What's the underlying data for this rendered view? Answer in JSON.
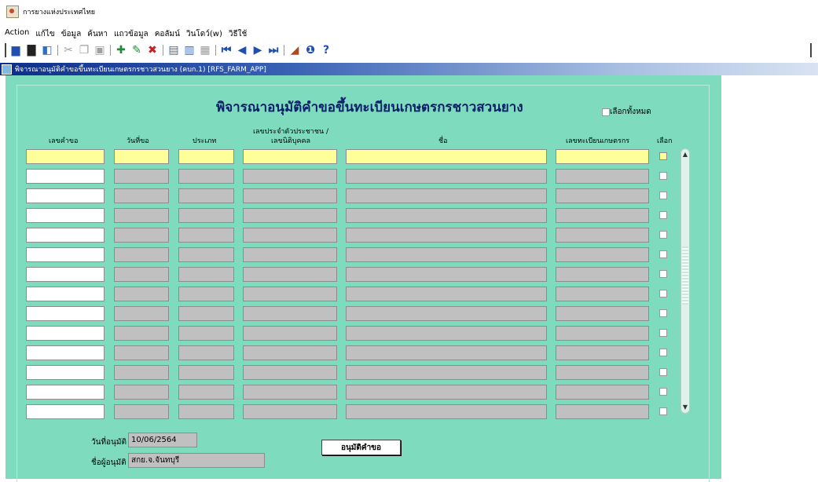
{
  "app": {
    "title": "การยางแห่งประเทศไทย"
  },
  "menu": [
    "Action",
    "แก้ไข",
    "ข้อมูล",
    "ค้นหา",
    "แถวข้อมูล",
    "คอลัมน์",
    "วินโดว์(w)",
    "วิธีใช้"
  ],
  "toolbar": [
    {
      "icon": "save-icon",
      "glyph": "▆",
      "color": "#1f4fb0"
    },
    {
      "icon": "print-icon",
      "glyph": "▇",
      "color": "#222222"
    },
    {
      "icon": "exit-icon",
      "glyph": "◧",
      "color": "#2a6fd0"
    },
    {
      "sep": true
    },
    {
      "icon": "cut-icon",
      "glyph": "✂",
      "color": "#a0a0a0"
    },
    {
      "icon": "copy-icon",
      "glyph": "❐",
      "color": "#a0a0a0"
    },
    {
      "icon": "paste-icon",
      "glyph": "▣",
      "color": "#a0a0a0"
    },
    {
      "sep": true
    },
    {
      "icon": "insert-record-icon",
      "glyph": "✚",
      "color": "#1e8a3a"
    },
    {
      "icon": "edit-record-icon",
      "glyph": "✎",
      "color": "#1e8a3a"
    },
    {
      "icon": "delete-record-icon",
      "glyph": "✖",
      "color": "#c81e1e"
    },
    {
      "sep": true
    },
    {
      "icon": "query-icon",
      "glyph": "▤",
      "color": "#2a6fd0"
    },
    {
      "icon": "execute-query-icon",
      "glyph": "▥",
      "color": "#2a6fd0"
    },
    {
      "icon": "cancel-query-icon",
      "glyph": "▦",
      "color": "#9a9a9a"
    },
    {
      "sep": true
    },
    {
      "icon": "first-record-icon",
      "glyph": "⏮",
      "color": "#1f4fb0"
    },
    {
      "icon": "previous-record-icon",
      "glyph": "◀",
      "color": "#1f4fb0"
    },
    {
      "icon": "next-record-icon",
      "glyph": "▶",
      "color": "#1f4fb0"
    },
    {
      "icon": "last-record-icon",
      "glyph": "⏭",
      "color": "#1f4fb0"
    },
    {
      "sep": true
    },
    {
      "icon": "chart-icon",
      "glyph": "◢",
      "color": "#b04a1a"
    },
    {
      "icon": "info-icon",
      "glyph": "❶",
      "color": "#1f4fb0"
    },
    {
      "icon": "help-icon",
      "glyph": "?",
      "color": "#1f4fb0"
    }
  ],
  "window": {
    "title": "พิจารณาอนุมัติคำขอขึ้นทะเบียนเกษตรกรชาวสวนยาง (คบก.1) [RFS_FARM_APP]"
  },
  "form": {
    "title": "พิจารณาอนุมัติคำขอขึ้นทะเบียนเกษตรกรชาวสวนยาง",
    "select_all": "เลือกทั้งหมด",
    "columns": {
      "request_no": "เลขคำขอ",
      "request_date": "วันที่ขอ",
      "type": "ประเภท",
      "id_line1": "เลขประจำตัวประชาชน /",
      "id_line2": "เลขนิติบุคคล",
      "name": "ชื่อ",
      "farmer_reg": "เลขทะเบียนเกษตรกร",
      "select": "เลือก"
    },
    "row_count": 14,
    "approve_date_label": "วันที่อนุมัติ",
    "approve_date_value": "10/06/2564",
    "approver_label": "ชื่อผู้อนุมัติ",
    "approver_value": "สกย.จ.จันทบุรี",
    "approve_button": "อนุมัติคำขอ"
  }
}
